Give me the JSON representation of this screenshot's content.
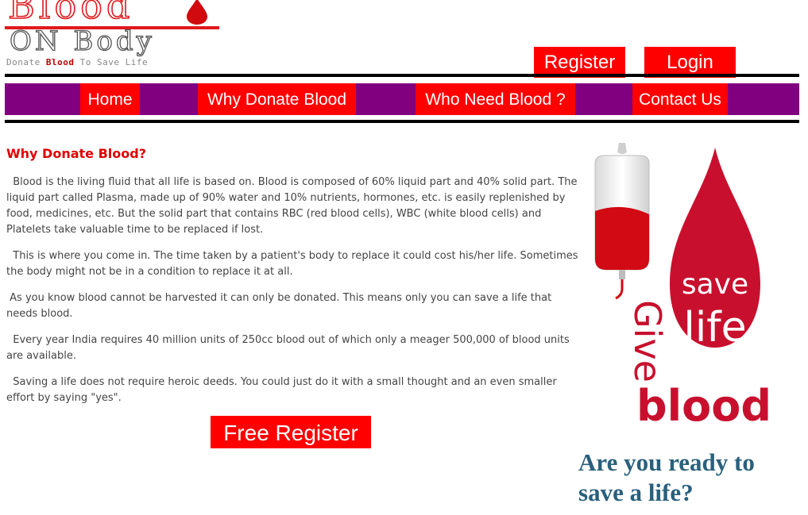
{
  "logo": {
    "title": "Blood",
    "subtitle": "ON Body",
    "tagline_prefix": "Donate ",
    "tagline_highlight": "Blood",
    "tagline_suffix": " To Save Life"
  },
  "header": {
    "register_label": "Register",
    "login_label": "Login"
  },
  "nav": {
    "items": [
      {
        "label": "Home"
      },
      {
        "label": "Why Donate Blood"
      },
      {
        "label": "Who Need Blood ?"
      },
      {
        "label": "Contact Us"
      }
    ]
  },
  "main": {
    "title": "Why Donate Blood?",
    "paragraphs": [
      "  Blood is the living fluid that all life is based on. Blood is composed of 60% liquid part and 40% solid part. The liquid part called Plasma, made up of 90% water and 10% nutrients, hormones, etc. is easily replenished by food, medicines, etc. But the solid part that contains RBC (red blood cells), WBC (white blood cells) and Platelets take valuable time to be replaced if lost.",
      "  This is where you come in. The time taken by a patient's body to replace it could cost his/her life. Sometimes the body might not be in a condition to replace it at all.",
      " As you know blood cannot be harvested it can only be donated. This means only you can save a life that needs blood.",
      "  Every year India requires 40 million units of 250cc blood out of which only a meager 500,000 of blood units are available.",
      "  Saving a life does not require heroic deeds. You could just do it with a small thought and an even smaller effort by saying \"yes\"."
    ],
    "cta_label": "Free Register"
  },
  "poster": {
    "line1": "save",
    "line2": "life",
    "give": "Give",
    "blood": "blood"
  },
  "side": {
    "tagline": "Are you ready to save a life?"
  },
  "colors": {
    "accent_red": "#ff0000",
    "nav_purple": "#800080",
    "blood_red": "#c8102e",
    "tagline_blue": "#29607c"
  }
}
